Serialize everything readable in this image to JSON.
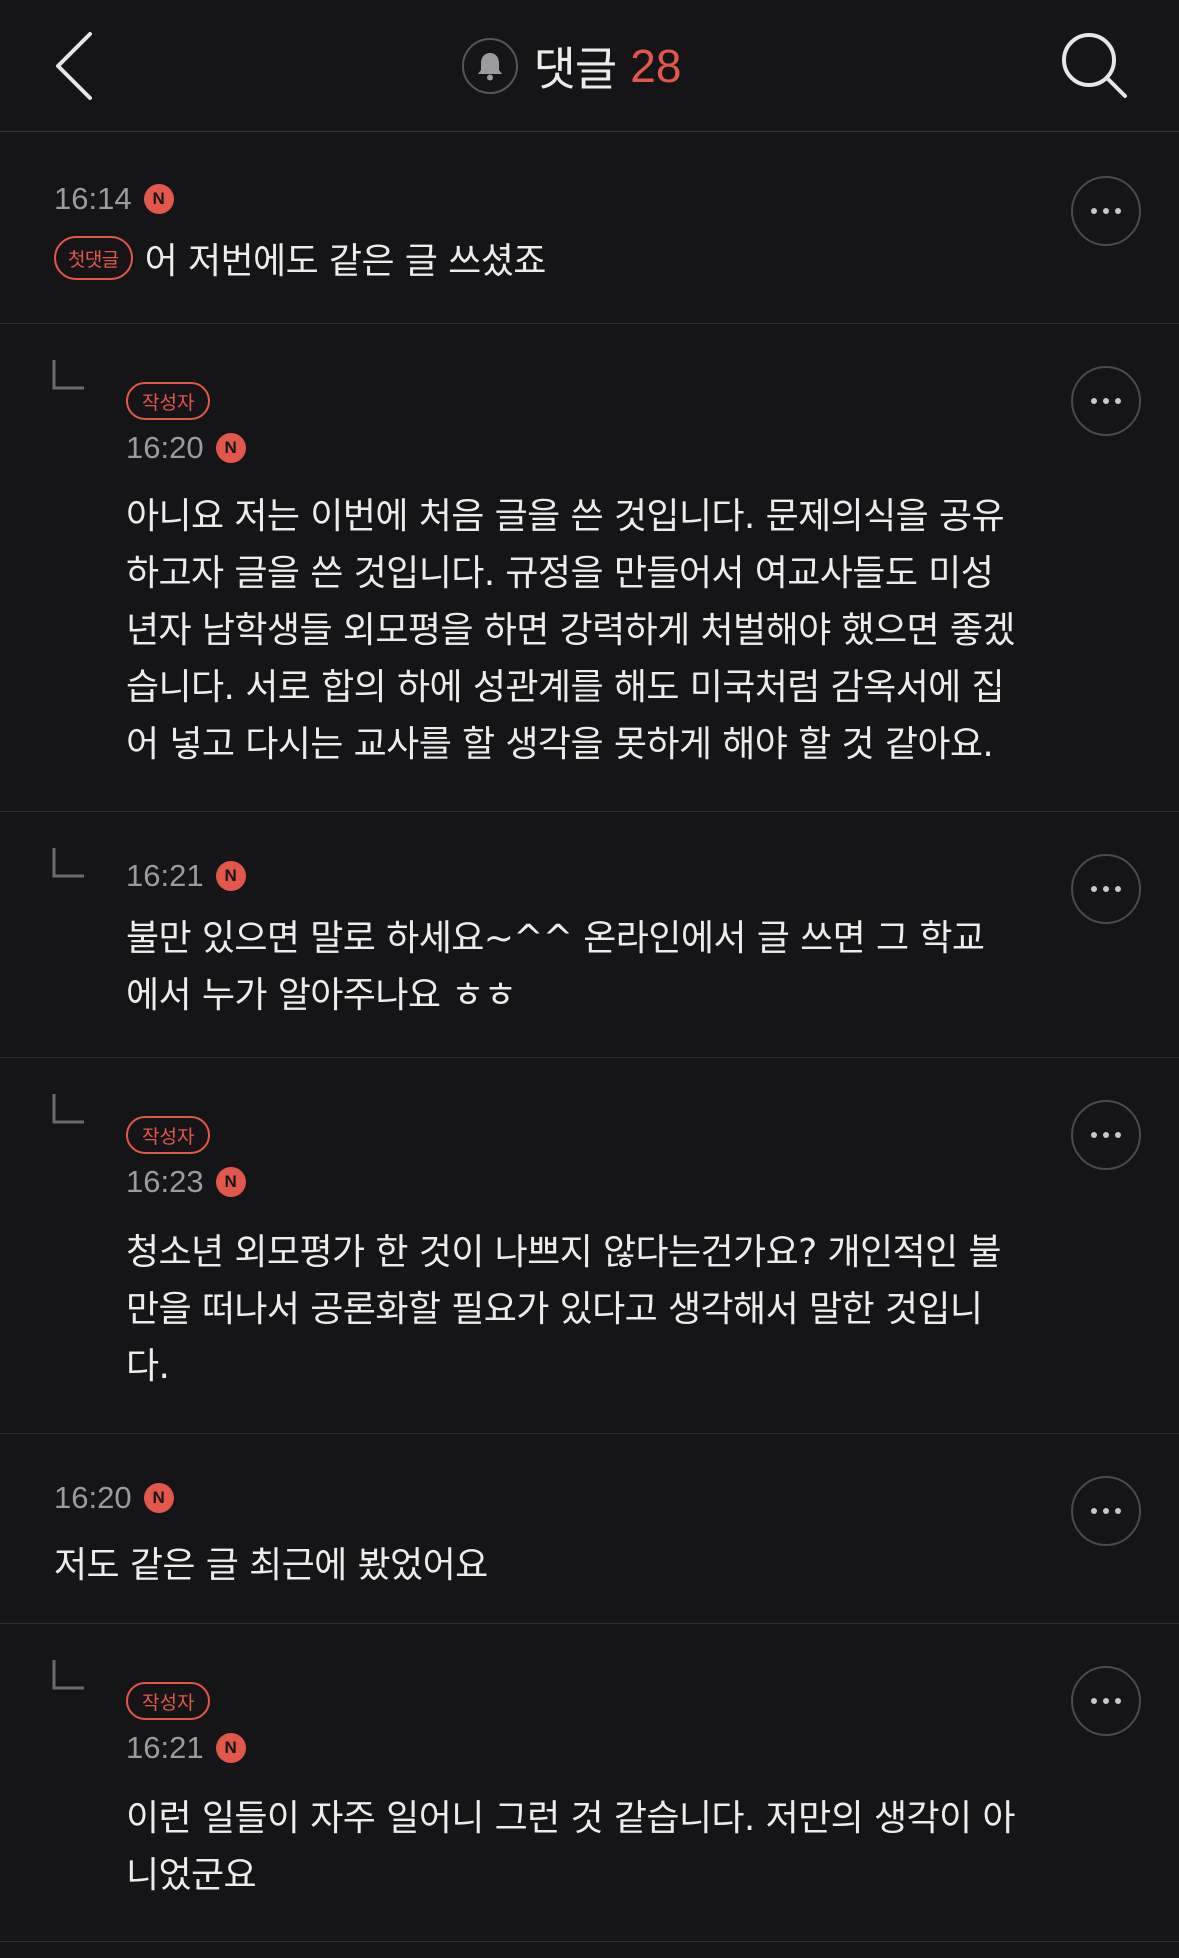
{
  "header": {
    "title": "댓글",
    "count": "28",
    "back_icon": "chevron-left-icon",
    "bell_icon": "bell-icon",
    "search_icon": "search-icon"
  },
  "badges": {
    "new": "N",
    "author": "작성자",
    "first_comment": "첫댓글"
  },
  "comments": [
    {
      "time": "16:14",
      "text": "어 저번에도 같은 글 쓰셨죠",
      "is_reply": false,
      "first_comment": true
    },
    {
      "time": "16:20",
      "text": "아니요 저는 이번에 처음 글을 쓴 것입니다. 문제의식을 공유하고자 글을 쓴 것입니다. 규정을 만들어서 여교사들도 미성년자 남학생들 외모평을 하면 강력하게 처벌해야 했으면 좋겠습니다. 서로 합의 하에 성관계를 해도 미국처럼 감옥서에 집어 넣고 다시는 교사를 할 생각을 못하게 해야 할 것 같아요.",
      "lines": [
        "아니요 저는 이번에 처음 글을 쓴 것입니다. 문제의식을 공유",
        "하고자 글을 쓴 것입니다. 규정을 만들어서 여교사들도 미성",
        "년자 남학생들 외모평을 하면 강력하게 처벌해야 했으면 좋겠",
        "습니다. 서로 합의 하에 성관계를 해도 미국처럼 감옥서에 집",
        "어 넣고 다시는 교사를 할 생각을 못하게 해야 할 것 같아요."
      ],
      "is_reply": true,
      "author": true
    },
    {
      "time": "16:21",
      "lines": [
        "불만 있으면 말로 하세요~^^ 온라인에서 글 쓰면 그 학교",
        "에서 누가 알아주나요 ㅎㅎ"
      ],
      "is_reply": true,
      "author": false
    },
    {
      "time": "16:23",
      "lines": [
        "청소년 외모평가 한 것이 나쁘지 않다는건가요? 개인적인 불",
        "만을 떠나서 공론화할 필요가 있다고 생각해서 말한 것입니",
        "다."
      ],
      "is_reply": true,
      "author": true
    },
    {
      "time": "16:20",
      "text": "저도 같은 글 최근에 봤었어요",
      "is_reply": false,
      "first_comment": false
    },
    {
      "time": "16:21",
      "lines": [
        "이런 일들이 자주 일어니 그런 것 같습니다. 저만의 생각이 아",
        "니었군요"
      ],
      "is_reply": true,
      "author": true
    }
  ],
  "colors": {
    "background": "#151518",
    "accent": "#e2574c",
    "text": "#ececed",
    "meta": "#9a9aa0",
    "divider": "#2e2e33"
  }
}
